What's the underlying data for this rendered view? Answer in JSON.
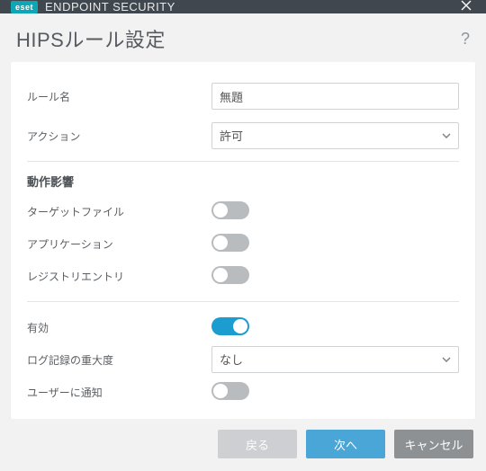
{
  "titlebar": {
    "brand_badge": "eset",
    "product_name": "ENDPOINT SECURITY"
  },
  "page": {
    "title": "HIPSルール設定"
  },
  "rule_name": {
    "label": "ルール名",
    "value": "無題"
  },
  "action": {
    "label": "アクション",
    "selected": "許可"
  },
  "operations": {
    "heading": "動作影響",
    "target_files_label": "ターゲットファイル",
    "target_files_on": false,
    "applications_label": "アプリケーション",
    "applications_on": false,
    "registry_label": "レジストリエントリ",
    "registry_on": false
  },
  "enabled": {
    "label": "有効",
    "on": true
  },
  "severity": {
    "label": "ログ記録の重大度",
    "selected": "なし"
  },
  "notify": {
    "label": "ユーザーに通知",
    "on": false
  },
  "buttons": {
    "back": "戻る",
    "next": "次へ",
    "cancel": "キャンセル"
  }
}
